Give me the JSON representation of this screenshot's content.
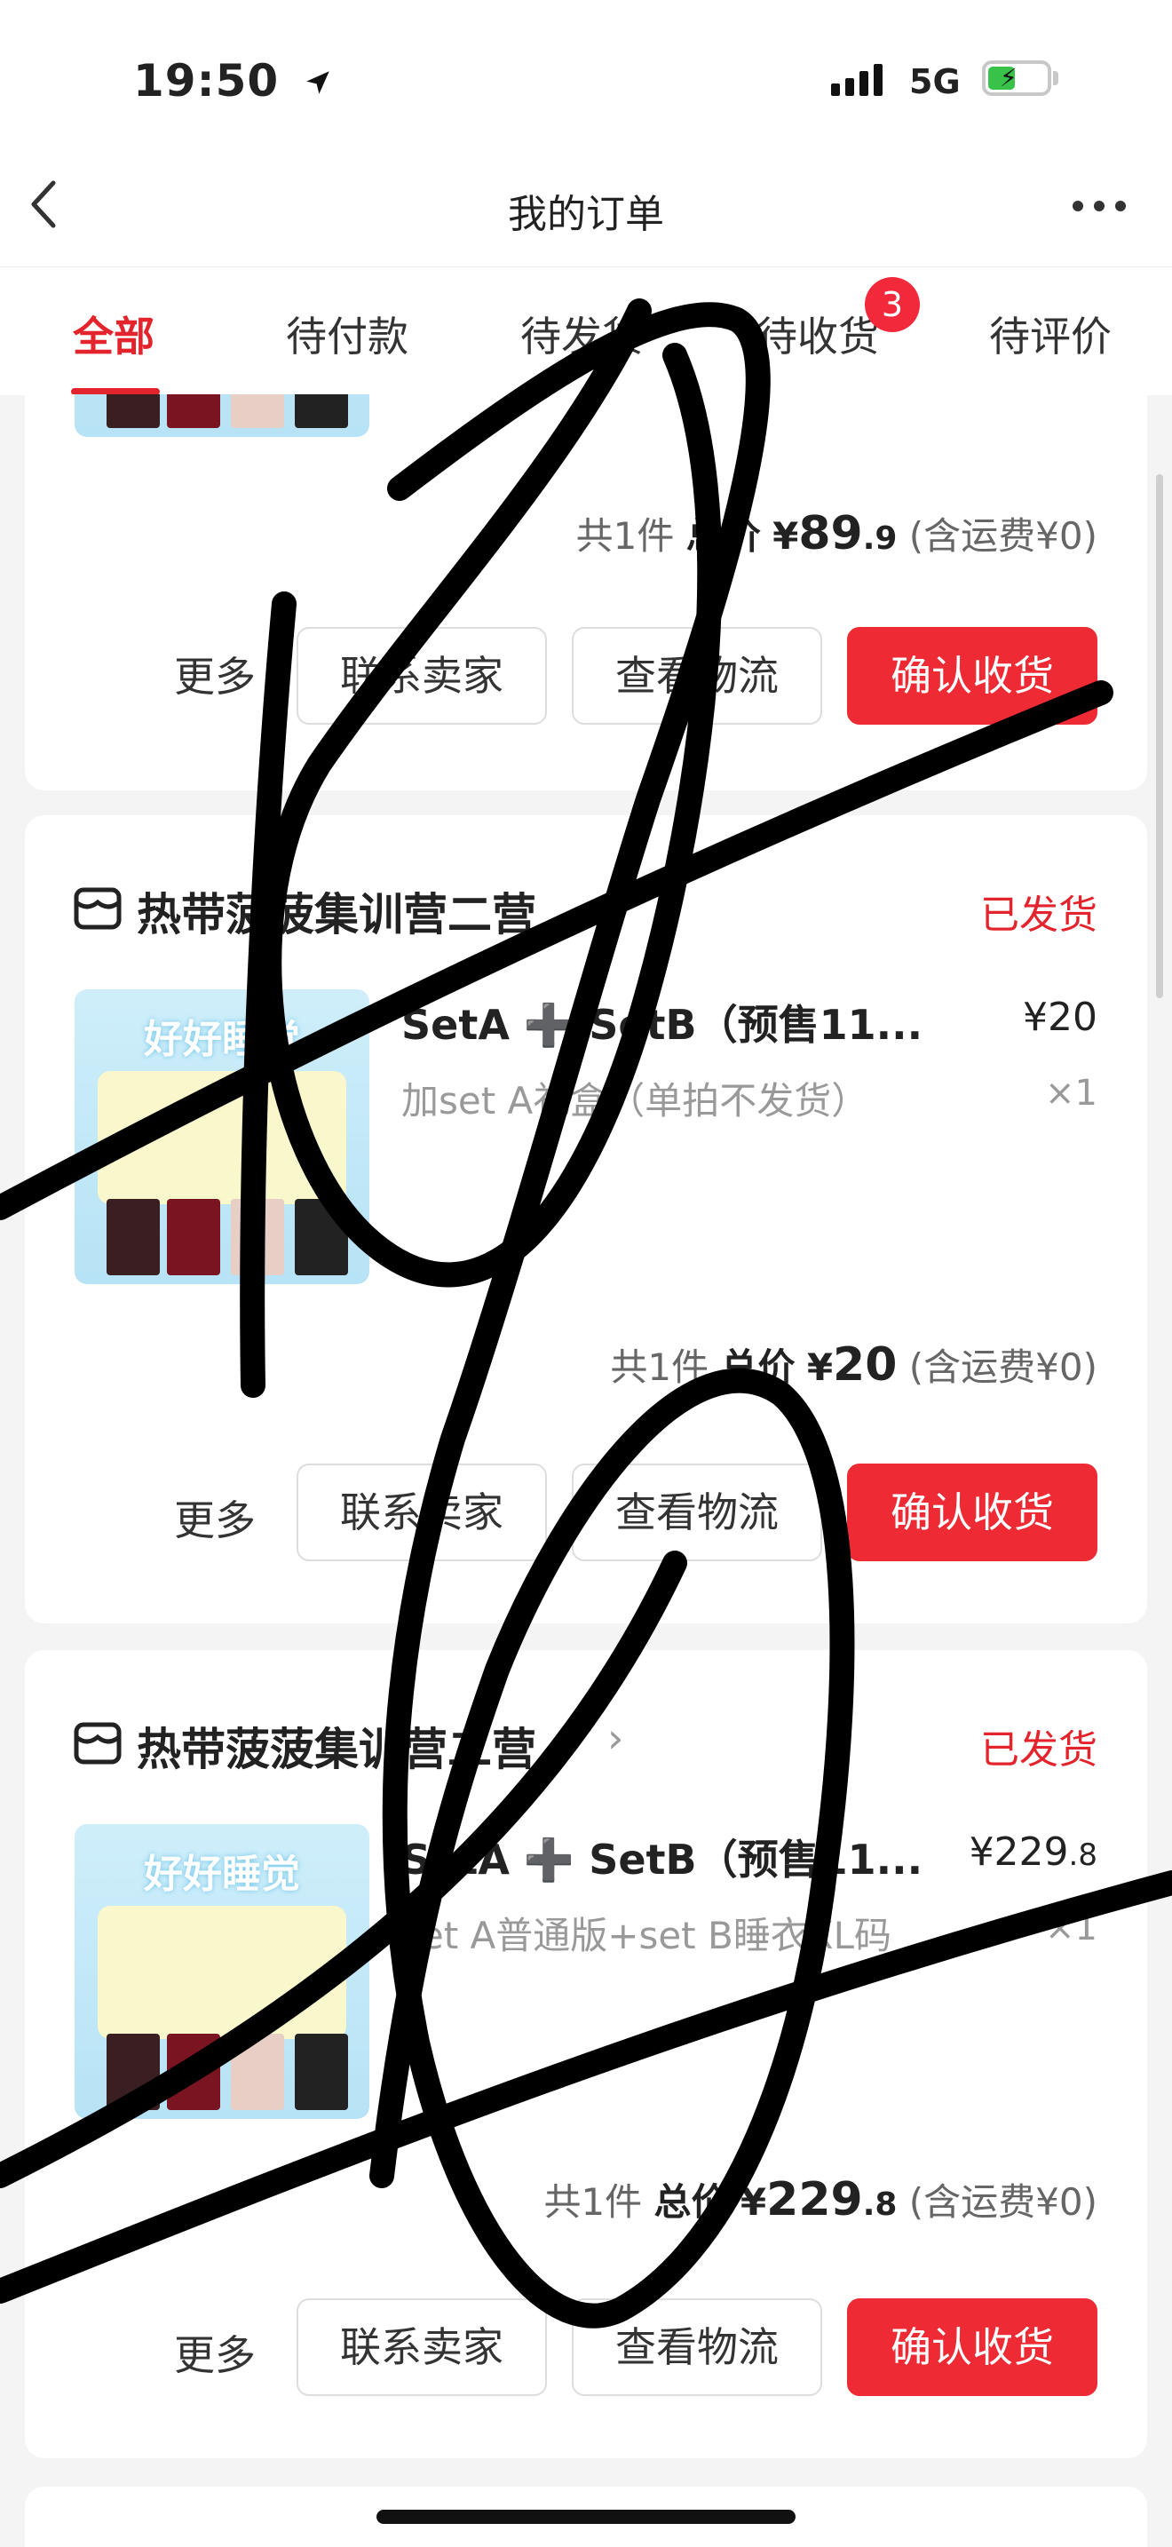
{
  "status_bar": {
    "time": "19:50",
    "network": "5G"
  },
  "header": {
    "title": "我的订单"
  },
  "tabs": [
    {
      "label": "全部",
      "active": true
    },
    {
      "label": "待付款"
    },
    {
      "label": "待发货"
    },
    {
      "label": "待收货",
      "badge": "3"
    },
    {
      "label": "待评价"
    }
  ],
  "orders": [
    {
      "total_prefix": "共1件",
      "total_label": "总价",
      "currency": "¥",
      "total_int": "89",
      "total_dec": ".9",
      "shipping": "(含运费¥0)",
      "more": "更多",
      "buttons": [
        "联系卖家",
        "查看物流",
        "确认收货"
      ]
    },
    {
      "shop": "热带菠菠集训营二营",
      "status": "已发货",
      "product_name": "SetA ➕ SetB（预售11...",
      "price": "¥20",
      "variant": "加set A礼盒（单拍不发货）",
      "qty": "×1",
      "total_prefix": "共1件",
      "total_label": "总价",
      "currency": "¥",
      "total_int": "20",
      "total_dec": "",
      "shipping": "(含运费¥0)",
      "more": "更多",
      "buttons": [
        "联系卖家",
        "查看物流",
        "确认收货"
      ]
    },
    {
      "shop": "热带菠菠集训营二营",
      "status": "已发货",
      "product_name": "SetA ➕ SetB（预售11...",
      "price_int": "¥229",
      "price_dec": ".8",
      "variant": "set A普通版+set B睡衣XL码",
      "qty": "×1",
      "total_prefix": "共1件",
      "total_label": "总价",
      "currency": "¥",
      "total_int": "229",
      "total_dec": ".8",
      "shipping": "(含运费¥0)",
      "more": "更多",
      "buttons": [
        "联系卖家",
        "查看物流",
        "确认收货"
      ]
    }
  ],
  "colors": {
    "accent": "#e4242c",
    "button_primary": "#ee2b34",
    "badge": "#f2283b",
    "background": "#f4f4f4"
  },
  "icons": [
    "location-arrow-icon",
    "signal-icon",
    "battery-charging-icon",
    "back-chevron-icon",
    "more-dots-icon",
    "shop-icon",
    "chevron-right-icon"
  ]
}
